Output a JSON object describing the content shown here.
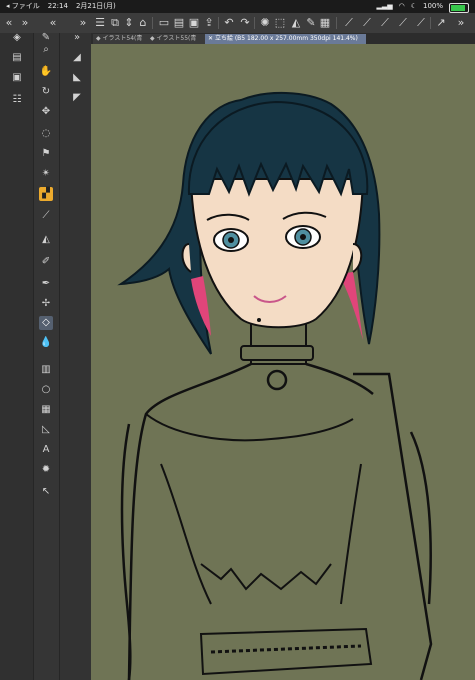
{
  "status": {
    "back_label": "◂ ファイル",
    "time": "22:14",
    "date": "2月21日(月)",
    "battery": "100%",
    "battery_level": 1.0
  },
  "tabs": [
    {
      "label": "イラスト54(青",
      "active": false
    },
    {
      "label": "イラスト55(青",
      "active": false
    },
    {
      "label": "立ち絵 (B5 182.00 x 257.00mm 350dpi 141.4%)",
      "active": true
    }
  ],
  "colors": {
    "canvas_bg": "#6f7455",
    "accent_tool": "#ecaa2d",
    "hair": "#163544",
    "hair_highlight": "#e0457a",
    "skin": "#f4dcc5",
    "foreground_color": "#e99a9a"
  },
  "tool_icons": [
    "layers-icon",
    "navigator-icon",
    "sub-tool-icon",
    "properties-icon",
    "zoom-icon",
    "hand-icon",
    "rotate-icon",
    "move-icon",
    "lasso-icon",
    "auto-select-icon",
    "eyedropper-icon",
    "pen-icon",
    "pencil-icon",
    "brush-icon",
    "airbrush-icon",
    "eraser-icon",
    "blend-icon",
    "fill-icon",
    "gradient-icon",
    "shape-icon",
    "frame-icon",
    "ruler-icon",
    "text-icon",
    "balloon-icon",
    "correction-icon"
  ]
}
